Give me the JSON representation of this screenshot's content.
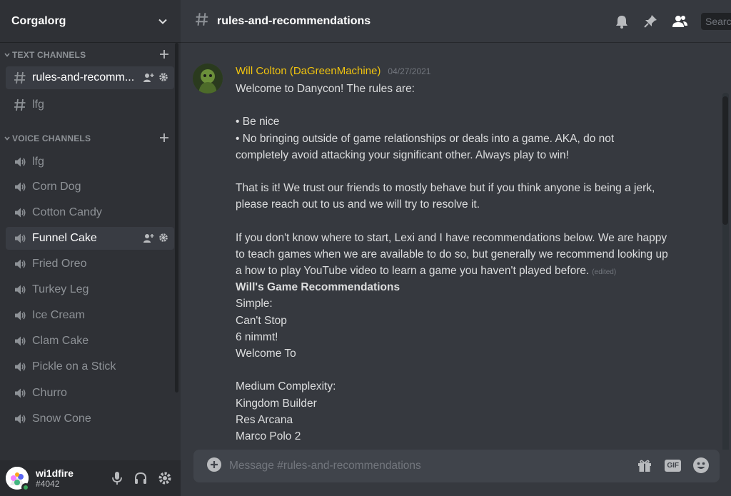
{
  "guild": {
    "name": "Corgalorg"
  },
  "categories": {
    "text": {
      "label": "TEXT CHANNELS"
    },
    "voice": {
      "label": "VOICE CHANNELS"
    }
  },
  "text_channels": [
    {
      "name": "rules-and-recomm...",
      "selected": true
    },
    {
      "name": "lfg",
      "selected": false
    }
  ],
  "voice_channels": [
    {
      "name": "lfg"
    },
    {
      "name": "Corn Dog"
    },
    {
      "name": "Cotton Candy"
    },
    {
      "name": "Funnel Cake",
      "active": true
    },
    {
      "name": "Fried Oreo"
    },
    {
      "name": "Turkey Leg"
    },
    {
      "name": "Ice Cream"
    },
    {
      "name": "Clam Cake"
    },
    {
      "name": "Pickle on a Stick"
    },
    {
      "name": "Churro"
    },
    {
      "name": "Snow Cone"
    }
  ],
  "user": {
    "name": "wi1dfire",
    "tag": "#4042",
    "status_color": "#3ba55d"
  },
  "header": {
    "channel": "rules-and-recommendations",
    "search_placeholder": "Search"
  },
  "message": {
    "author": "Will Colton (DaGreenMachine)",
    "author_color": "#f1c40f",
    "timestamp": "04/27/2021",
    "edited_label": "(edited)",
    "lines": [
      "Welcome to Danycon! The rules are:",
      "",
      "• Be nice",
      "• No bringing outside of game relationships or deals into a game. AKA, do not",
      "completely avoid attacking your significant other. Always play to win!",
      "",
      "That is it! We trust our friends to mostly behave but if you think anyone is being a jerk,",
      "please reach out to us and we will try to resolve it.",
      "",
      "If you don't know where to start, Lexi and I have recommendations below.  We are happy",
      "to teach games when we are available to do so, but generally we recommend looking up",
      "a how to play YouTube video to learn a game you haven't played before."
    ],
    "recs_title": "Will's Game Recommendations",
    "recs": [
      "Simple:",
      "Can't Stop",
      "6 nimmt!",
      "Welcome To",
      "",
      "Medium Complexity:",
      "Kingdom Builder",
      "Res Arcana",
      "Marco Polo 2"
    ]
  },
  "composer": {
    "placeholder": "Message #rules-and-recommendations",
    "gif_label": "GIF"
  },
  "icons": {
    "channel": "hash-icon",
    "voice": "speaker-icon",
    "bell": "bell-icon",
    "pin": "pin-icon",
    "members": "members-icon",
    "gift": "gift-icon",
    "emoji": "emoji-icon",
    "mic": "microphone-icon",
    "headset": "headphones-icon",
    "settings": "gear-icon"
  }
}
